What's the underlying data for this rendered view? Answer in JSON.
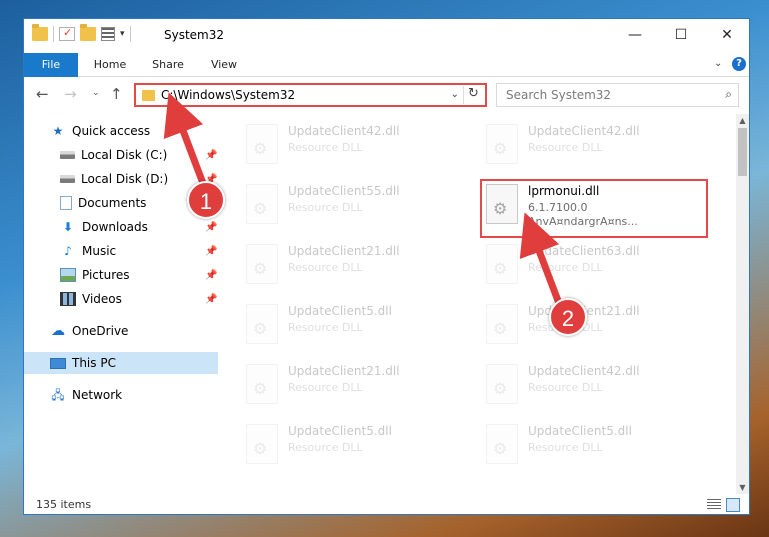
{
  "window": {
    "title": "System32",
    "controls": {
      "minimize": "—",
      "maximize": "☐",
      "close": "✕"
    }
  },
  "qat": {
    "icons": [
      "folder-icon",
      "properties-icon",
      "new-folder-icon",
      "view-icon"
    ]
  },
  "ribbon": {
    "tabs": [
      {
        "label": "File"
      },
      {
        "label": "Home"
      },
      {
        "label": "Share"
      },
      {
        "label": "View"
      }
    ],
    "help": "?"
  },
  "nav": {
    "address": "C:\\Windows\\System32",
    "search_placeholder": "Search System32"
  },
  "sidebar": {
    "items": [
      {
        "label": "Quick access",
        "icon": "star-icon"
      },
      {
        "label": "Local Disk (C:)",
        "icon": "disk-icon",
        "pinned": true
      },
      {
        "label": "Local Disk (D:)",
        "icon": "disk-icon",
        "pinned": true
      },
      {
        "label": "Documents",
        "icon": "documents-icon",
        "pinned": true
      },
      {
        "label": "Downloads",
        "icon": "downloads-icon",
        "pinned": true
      },
      {
        "label": "Music",
        "icon": "music-icon",
        "pinned": true
      },
      {
        "label": "Pictures",
        "icon": "pictures-icon",
        "pinned": true
      },
      {
        "label": "Videos",
        "icon": "videos-icon",
        "pinned": true
      },
      {
        "label": "OneDrive",
        "icon": "onedrive-icon"
      },
      {
        "label": "This PC",
        "icon": "this-pc-icon",
        "selected": true
      },
      {
        "label": "Network",
        "icon": "network-icon"
      }
    ]
  },
  "files": [
    {
      "name": "UpdateClient42.dll",
      "meta": "Resource DLL",
      "faded": true
    },
    {
      "name": "UpdateClient42.dll",
      "meta": "Resource DLL",
      "faded": true
    },
    {
      "name": "UpdateClient55.dll",
      "meta": "Resource DLL",
      "faded": true
    },
    {
      "name": "lprmonui.dll",
      "version": "6.1.7100.0",
      "company": "AnvA¤ndargrA¤ns...",
      "faded": false,
      "highlighted": true
    },
    {
      "name": "UpdateClient21.dll",
      "meta": "Resource DLL",
      "faded": true
    },
    {
      "name": "UpdateClient63.dll",
      "meta": "Resource DLL",
      "faded": true
    },
    {
      "name": "UpdateClient5.dll",
      "meta": "Resource DLL",
      "faded": true
    },
    {
      "name": "UpdateClient21.dll",
      "meta": "Resource DLL",
      "faded": true
    },
    {
      "name": "UpdateClient21.dll",
      "meta": "Resource DLL",
      "faded": true
    },
    {
      "name": "UpdateClient42.dll",
      "meta": "Resource DLL",
      "faded": true
    },
    {
      "name": "UpdateClient5.dll",
      "meta": "Resource DLL",
      "faded": true
    },
    {
      "name": "UpdateClient5.dll",
      "meta": "Resource DLL",
      "faded": true
    }
  ],
  "status": {
    "item_count": "135 items"
  },
  "annotations": {
    "badge1": "1",
    "badge2": "2",
    "color": "#e03d3d"
  }
}
